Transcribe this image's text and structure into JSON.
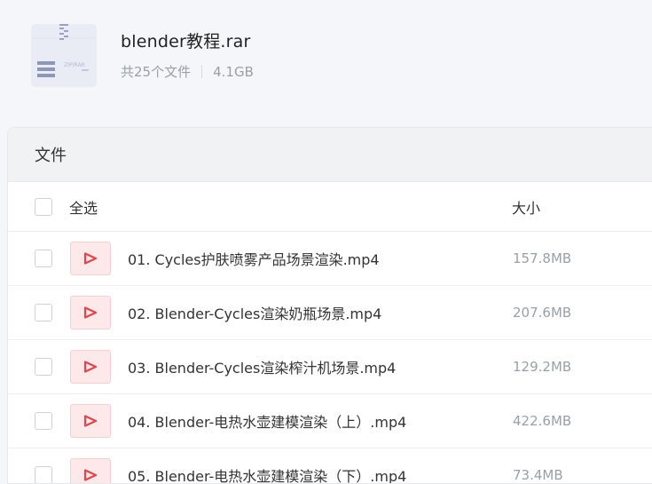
{
  "archive": {
    "title": "blender教程.rar",
    "file_count": "共25个文件",
    "total_size": "4.1GB",
    "icon_text": "ZIP/RAR"
  },
  "panel": {
    "title": "文件",
    "select_all": "全选",
    "size_header": "大小"
  },
  "files": [
    {
      "name": "01. Cycles护肤喷雾产品场景渲染.mp4",
      "size": "157.8MB"
    },
    {
      "name": "02. Blender-Cycles渲染奶瓶场景.mp4",
      "size": "207.6MB"
    },
    {
      "name": "03. Blender-Cycles渲染榨汁机场景.mp4",
      "size": "129.2MB"
    },
    {
      "name": "04. Blender-电热水壶建模渲染（上）.mp4",
      "size": "422.6MB"
    },
    {
      "name": "05. Blender-电热水壶建模渲染（下）.mp4",
      "size": "73.4MB"
    }
  ],
  "colors": {
    "accent_red": "#e8434b",
    "icon_bg": "#fde9ea"
  }
}
